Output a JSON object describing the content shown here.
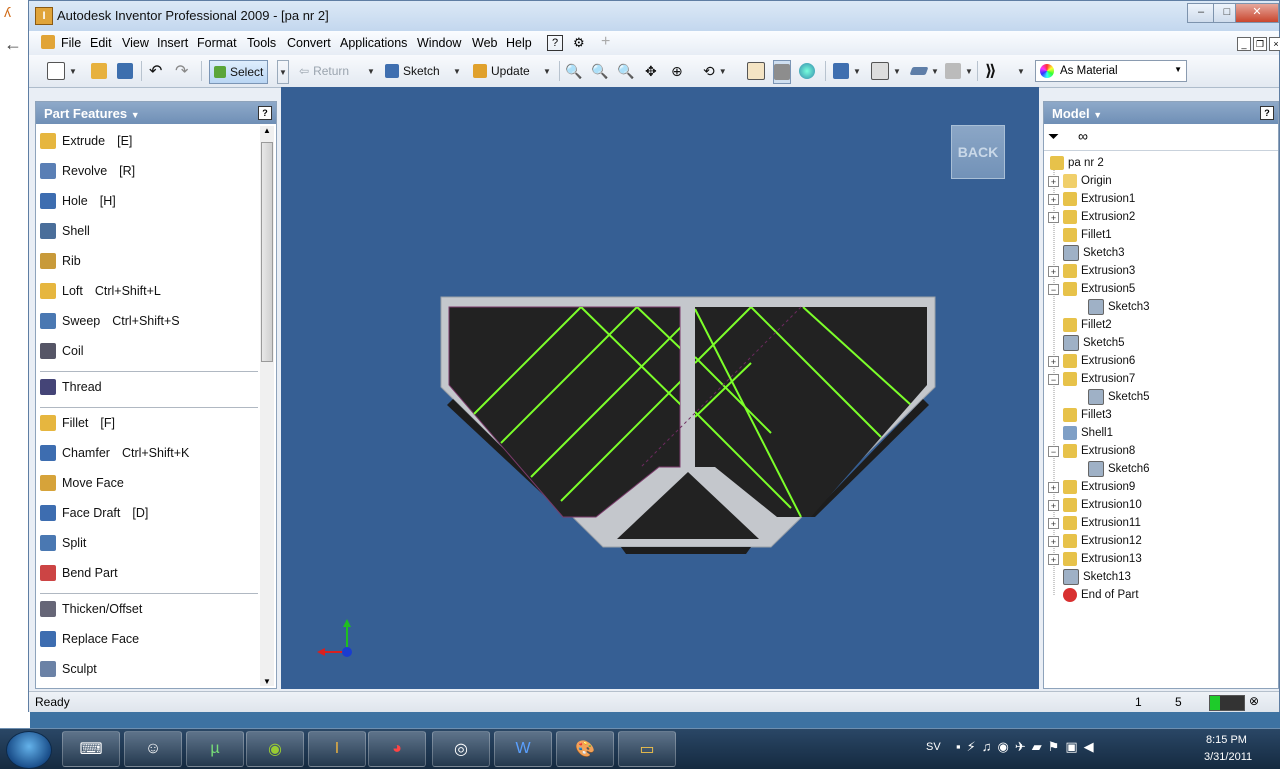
{
  "window": {
    "title": "Autodesk Inventor Professional 2009 - [pa nr 2]"
  },
  "menu": [
    "File",
    "Edit",
    "View",
    "Insert",
    "Format",
    "Tools",
    "Convert",
    "Applications",
    "Window",
    "Web",
    "Help"
  ],
  "toolbar": {
    "select": "Select",
    "return": "Return",
    "sketch": "Sketch",
    "update": "Update",
    "material": "As Material"
  },
  "part_features": {
    "title": "Part Features",
    "items": [
      {
        "label": "Extrude",
        "shortcut": "[E]",
        "icon": "extrude-icon"
      },
      {
        "label": "Revolve",
        "shortcut": "[R]",
        "icon": "revolve-icon"
      },
      {
        "label": "Hole",
        "shortcut": "[H]",
        "icon": "hole-icon"
      },
      {
        "label": "Shell",
        "shortcut": "",
        "icon": "shell-icon"
      },
      {
        "label": "Rib",
        "shortcut": "",
        "icon": "rib-icon"
      },
      {
        "label": "Loft",
        "shortcut": "Ctrl+Shift+L",
        "icon": "loft-icon"
      },
      {
        "label": "Sweep",
        "shortcut": "Ctrl+Shift+S",
        "icon": "sweep-icon"
      },
      {
        "label": "Coil",
        "shortcut": "",
        "icon": "coil-icon"
      },
      {
        "label": "Thread",
        "shortcut": "",
        "icon": "thread-icon"
      },
      {
        "label": "Fillet",
        "shortcut": "[F]",
        "icon": "fillet-icon"
      },
      {
        "label": "Chamfer",
        "shortcut": "Ctrl+Shift+K",
        "icon": "chamfer-icon"
      },
      {
        "label": "Move Face",
        "shortcut": "",
        "icon": "move-face-icon"
      },
      {
        "label": "Face Draft",
        "shortcut": "[D]",
        "icon": "face-draft-icon"
      },
      {
        "label": "Split",
        "shortcut": "",
        "icon": "split-icon"
      },
      {
        "label": "Bend Part",
        "shortcut": "",
        "icon": "bend-part-icon"
      },
      {
        "label": "Thicken/Offset",
        "shortcut": "",
        "icon": "thicken-icon"
      },
      {
        "label": "Replace Face",
        "shortcut": "",
        "icon": "replace-face-icon"
      },
      {
        "label": "Sculpt",
        "shortcut": "",
        "icon": "sculpt-icon"
      }
    ]
  },
  "viewport": {
    "back_label": "BACK"
  },
  "model": {
    "title": "Model",
    "nodes": [
      {
        "label": "pa nr 2",
        "kind": "part"
      },
      {
        "label": "Origin",
        "kind": "folder",
        "toggle": "+"
      },
      {
        "label": "Extrusion1",
        "kind": "extrusion",
        "toggle": "+"
      },
      {
        "label": "Extrusion2",
        "kind": "extrusion",
        "toggle": "+"
      },
      {
        "label": "Fillet1",
        "kind": "fillet",
        "toggle": ""
      },
      {
        "label": "Sketch3",
        "kind": "sketch",
        "toggle": ""
      },
      {
        "label": "Extrusion3",
        "kind": "extrusion",
        "toggle": "+"
      },
      {
        "label": "Extrusion5",
        "kind": "extrusion",
        "toggle": "−"
      },
      {
        "label": "Sketch3",
        "kind": "sketch",
        "toggle": "",
        "child": true
      },
      {
        "label": "Fillet2",
        "kind": "fillet",
        "toggle": ""
      },
      {
        "label": "Sketch5",
        "kind": "sketch",
        "toggle": ""
      },
      {
        "label": "Extrusion6",
        "kind": "extrusion",
        "toggle": "+"
      },
      {
        "label": "Extrusion7",
        "kind": "extrusion",
        "toggle": "−"
      },
      {
        "label": "Sketch5",
        "kind": "sketch",
        "toggle": "",
        "child": true
      },
      {
        "label": "Fillet3",
        "kind": "fillet",
        "toggle": ""
      },
      {
        "label": "Shell1",
        "kind": "shell",
        "toggle": ""
      },
      {
        "label": "Extrusion8",
        "kind": "extrusion",
        "toggle": "−"
      },
      {
        "label": "Sketch6",
        "kind": "sketch",
        "toggle": "",
        "child": true
      },
      {
        "label": "Extrusion9",
        "kind": "extrusion",
        "toggle": "+"
      },
      {
        "label": "Extrusion10",
        "kind": "extrusion",
        "toggle": "+"
      },
      {
        "label": "Extrusion11",
        "kind": "extrusion",
        "toggle": "+"
      },
      {
        "label": "Extrusion12",
        "kind": "extrusion",
        "toggle": "+"
      },
      {
        "label": "Extrusion13",
        "kind": "extrusion",
        "toggle": "+"
      },
      {
        "label": "Sketch13",
        "kind": "sketch",
        "toggle": ""
      },
      {
        "label": "End of Part",
        "kind": "end",
        "toggle": ""
      }
    ]
  },
  "status": {
    "text": "Ready",
    "num1": "1",
    "num2": "5"
  },
  "taskbar": {
    "lang": "SV",
    "time": "8:15 PM",
    "date": "3/31/2011"
  },
  "colors": {
    "viewport_bg": "#365f94",
    "green_lines": "#7cff2a"
  }
}
